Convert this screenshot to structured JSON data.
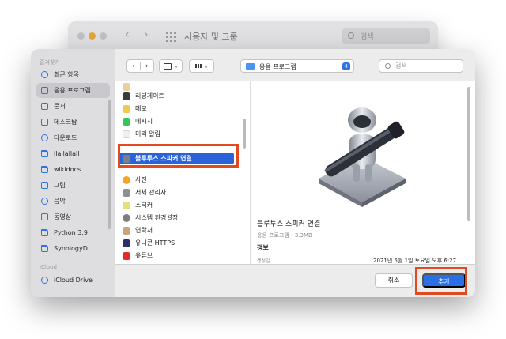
{
  "background_window": {
    "title": "사용자 및 그룹",
    "search_placeholder": "검색"
  },
  "sidebar": {
    "favorites_header": "즐겨찾기",
    "items": [
      {
        "label": "최근 항목",
        "icon": "clock-icon"
      },
      {
        "label": "응용 프로그램",
        "icon": "apps-icon",
        "active": true
      },
      {
        "label": "문서",
        "icon": "document-icon"
      },
      {
        "label": "데스크탑",
        "icon": "desktop-icon"
      },
      {
        "label": "다운로드",
        "icon": "download-icon"
      },
      {
        "label": "llallallall",
        "icon": "folder-icon"
      },
      {
        "label": "wikidocs",
        "icon": "folder-icon"
      },
      {
        "label": "그림",
        "icon": "pictures-icon"
      },
      {
        "label": "음악",
        "icon": "music-icon"
      },
      {
        "label": "동영상",
        "icon": "movies-icon"
      },
      {
        "label": "Python 3.9",
        "icon": "folder-icon"
      },
      {
        "label": "SynologyD...",
        "icon": "folder-icon"
      }
    ],
    "icloud_header": "iCloud",
    "icloud_items": [
      {
        "label": "iCloud Drive",
        "icon": "cloud-icon"
      }
    ]
  },
  "toolbar": {
    "back_label": "‹",
    "forward_label": "›",
    "path": "응용 프로그램",
    "search_placeholder": "검색"
  },
  "file_list": {
    "items": [
      {
        "label": "리딩게이트",
        "color": "#3b3b3d"
      },
      {
        "label": "메모",
        "color": "#f2c94c"
      },
      {
        "label": "메시지",
        "color": "#34c759"
      },
      {
        "label": "미리 알림",
        "color": "#f0f0f0"
      },
      {
        "label": "블루투스 스피커 연결",
        "color": "#7a7f8a",
        "selected": true
      },
      {
        "label": "사진",
        "color": "#f5a524"
      },
      {
        "label": "서체 관리자",
        "color": "#8e8e93"
      },
      {
        "label": "스티커",
        "color": "#e4e07a"
      },
      {
        "label": "시스템 환경설정",
        "color": "#7d7d82"
      },
      {
        "label": "연락처",
        "color": "#c7a67a"
      },
      {
        "label": "유니콘 HTTPS",
        "color": "#2d2d6e"
      },
      {
        "label": "유튜브",
        "color": "#e32a2a"
      }
    ]
  },
  "preview": {
    "name": "블루투스 스피커 연결",
    "kind": "응용 프로그램 - 3.3MB",
    "info_header": "정보",
    "created_label": "생성일",
    "created_value": "2021년 5월 1일 토요일 오후 6:27"
  },
  "buttons": {
    "cancel": "취소",
    "add": "추가"
  },
  "colors": {
    "accent": "#2a6fe6",
    "highlight_frame": "#e14a1f",
    "selection": "#2a62d9"
  }
}
